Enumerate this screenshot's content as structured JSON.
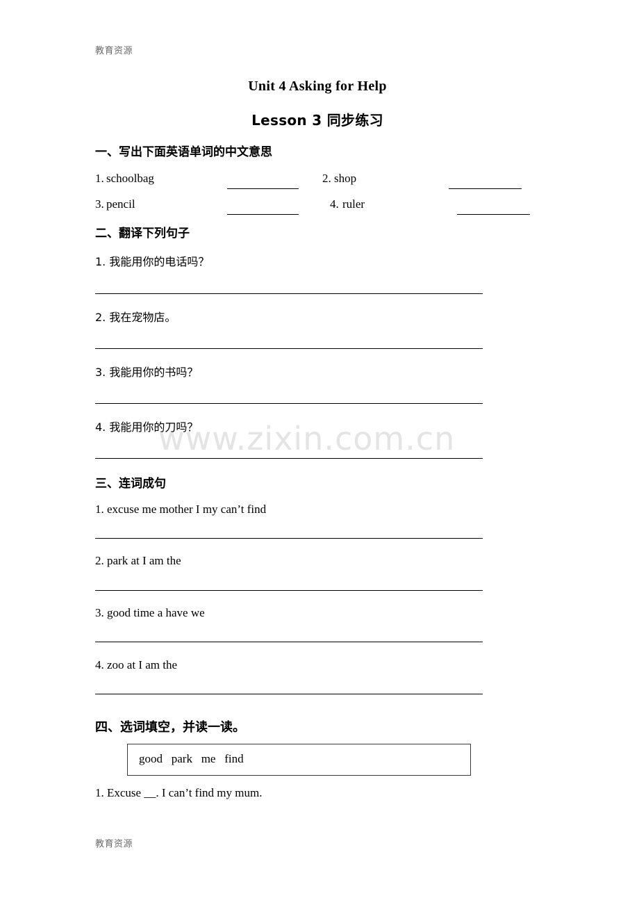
{
  "watermarks": {
    "header": "教育资源",
    "footer": "教育资源",
    "center": "www.zixin.com.cn"
  },
  "title": {
    "main": "Unit 4 Asking for Help",
    "sub": "Lesson 3  同步练习"
  },
  "sections": [
    {
      "heading": "一、写出下面英语单词的中文意思",
      "words": [
        {
          "num": "1.",
          "word": "schoolbag"
        },
        {
          "num": "2.",
          "word": "shop"
        },
        {
          "num": "3.",
          "word": "pencil"
        },
        {
          "num": "4.",
          "word": "ruler"
        }
      ]
    },
    {
      "heading": "二、翻译下列句子",
      "items": [
        "1. 我能用你的电话吗？",
        "2. 我在宠物店。",
        "3. 我能用你的书吗？",
        "4. 我能用你的刀吗？"
      ]
    },
    {
      "heading": "三、连词成句",
      "items": [
        "1. excuse me mother I my can’t find",
        "2. park at I am the",
        "3. good time a have we",
        "4. zoo at I am the"
      ]
    },
    {
      "heading": "四、选词填空，并读一读。",
      "word_bank": "good   park   me   find",
      "items": [
        "1. Excuse __. I can’t find my mum."
      ]
    }
  ]
}
